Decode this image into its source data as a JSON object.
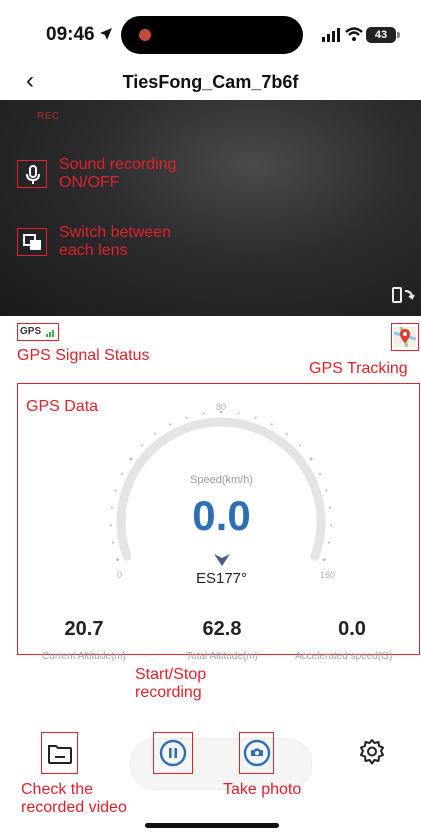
{
  "status_bar": {
    "time": "09:46",
    "battery": "43"
  },
  "nav": {
    "title": "TiesFong_Cam_7b6f",
    "back_icon": "chevron-left-icon"
  },
  "video": {
    "rec_label": "REC"
  },
  "stats": [
    {
      "value": "20.7",
      "label": "Current Altitude(m)"
    },
    {
      "value": "62.8",
      "label": "Total Altitude(m)"
    },
    {
      "value": "0.0",
      "label": "Accelerated speed(G)"
    }
  ],
  "gauge": {
    "speed_label": "Speed(km/h)",
    "speed_value": "0.0",
    "heading": "ES177°",
    "ticks": [
      "0",
      "80",
      "160"
    ],
    "level": 0
  },
  "annotations": {
    "sound": [
      "Sound recording",
      "ON/OFF"
    ],
    "lens": [
      "Switch between",
      "each lens"
    ],
    "gps_signal": "GPS Signal Status",
    "gps_tracking": "GPS Tracking",
    "gps_data": "GPS Data",
    "start_stop": [
      "Start/Stop",
      "recording"
    ],
    "check_video": [
      "Check the",
      "recorded video"
    ],
    "take_photo": "Take photo"
  },
  "gps_badge": "GPS",
  "colors": {
    "accent": "#2d6fb4",
    "annotation": "#e0222a"
  }
}
